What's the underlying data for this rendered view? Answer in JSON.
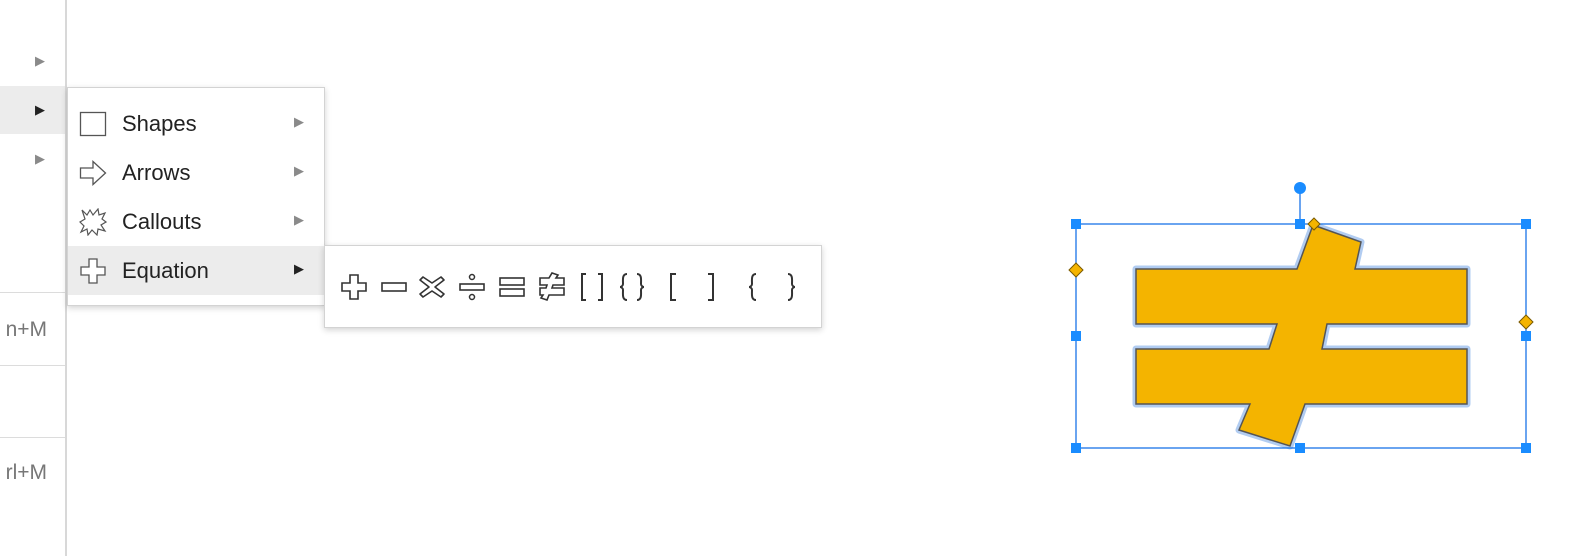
{
  "parent_menu": {
    "items": [
      {
        "arrow": "▶"
      },
      {
        "arrow": "▶",
        "active": true
      },
      {
        "arrow": "▶"
      }
    ],
    "shortcuts": [
      "n+M",
      "rl+M"
    ]
  },
  "submenu": {
    "items": [
      {
        "label": "Shapes",
        "icon": "rectangle-icon",
        "arrow": "▶"
      },
      {
        "label": "Arrows",
        "icon": "arrow-right-icon",
        "arrow": "▶"
      },
      {
        "label": "Callouts",
        "icon": "explosion-icon",
        "arrow": "▶"
      },
      {
        "label": "Equation",
        "icon": "plus-icon",
        "arrow": "▶",
        "active": true
      }
    ]
  },
  "equation_palette": {
    "items": [
      {
        "name": "plus-icon"
      },
      {
        "name": "minus-icon"
      },
      {
        "name": "multiply-icon"
      },
      {
        "name": "divide-icon"
      },
      {
        "name": "equal-icon"
      },
      {
        "name": "not-equal-icon"
      },
      {
        "name": "double-bracket-icon"
      },
      {
        "name": "double-brace-icon"
      },
      {
        "name": "left-bracket-icon"
      },
      {
        "name": "right-bracket-icon"
      },
      {
        "name": "left-brace-icon"
      },
      {
        "name": "right-brace-icon"
      }
    ]
  },
  "canvas": {
    "shape": "not-equal",
    "fill_color": "#f4b400",
    "stroke_color": "#555555",
    "glow_color": "#a9c7f0",
    "selection_color": "#1a73e8",
    "handle_color": "#1a8cff",
    "adjust_handle_color": "#f4b400"
  }
}
